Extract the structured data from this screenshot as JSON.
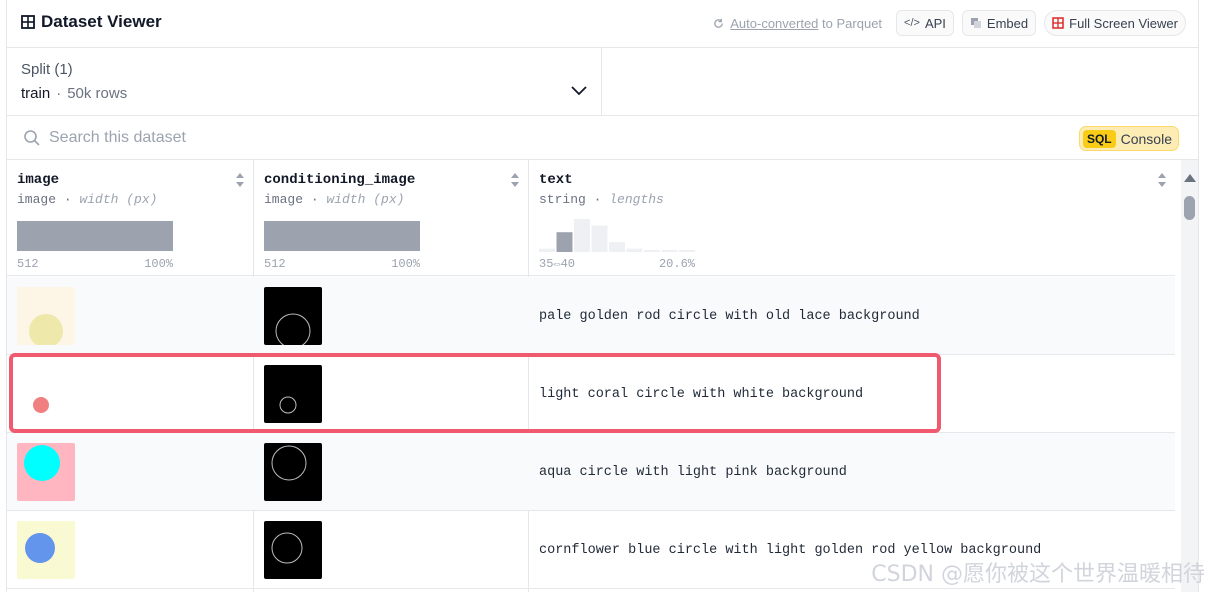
{
  "header": {
    "title": "Dataset Viewer",
    "auto_converted": "Auto-converted",
    "to_parquet": "to Parquet",
    "api_label": "API",
    "embed_label": "Embed",
    "fullscreen_label": "Full Screen Viewer"
  },
  "split": {
    "label": "Split (1)",
    "value": "train",
    "separator": "·",
    "rows": "50k rows"
  },
  "search": {
    "placeholder": "Search this dataset",
    "sql_badge": "SQL",
    "console_label": "Console"
  },
  "columns": [
    {
      "name": "image",
      "type": "image",
      "stat": "width (px)",
      "min": "512",
      "max": "100%"
    },
    {
      "name": "conditioning_image",
      "type": "image",
      "stat": "width (px)",
      "min": "512",
      "max": "100%"
    },
    {
      "name": "text",
      "type": "string",
      "stat": "lengths",
      "min": "35⇔40",
      "max": "20.6%"
    }
  ],
  "type_separator": "·",
  "length_histogram": [
    0.1,
    0.6,
    1.0,
    0.8,
    0.3,
    0.1,
    0.05,
    0.05,
    0.05
  ],
  "rows": [
    {
      "text": "pale golden rod circle with old lace background",
      "bg": "#fdf5e6",
      "circle": "#eee8aa",
      "cond_circle": "large"
    },
    {
      "text": "light coral circle with white background",
      "bg": "#ffffff",
      "circle": "#f08080",
      "cond_circle": "small"
    },
    {
      "text": "aqua circle with light pink background",
      "bg": "#ffb6c1",
      "circle": "#00ffff",
      "cond_circle": "large"
    },
    {
      "text": "cornflower blue circle with light golden rod yellow background",
      "bg": "#fafad2",
      "circle": "#6495ed",
      "cond_circle": "medium"
    }
  ],
  "watermark": "CSDN @愿你被这个世界温暖相待",
  "colors": {
    "highlight": "#ef5a6f",
    "sql_badge": "#facc15"
  }
}
